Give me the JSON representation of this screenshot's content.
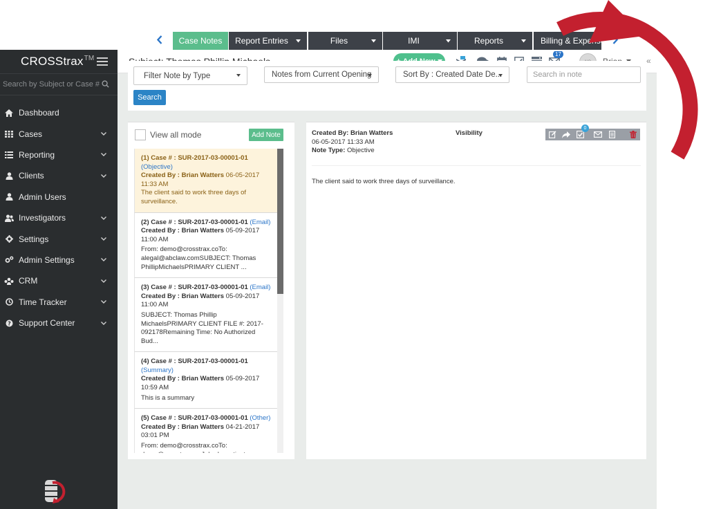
{
  "sidebar": {
    "brand": "CROSStrax",
    "brand_tm": "TM",
    "search_placeholder": "Search by Subject or Case #",
    "items": [
      {
        "label": "Dashboard",
        "icon": "home-icon"
      },
      {
        "label": "Cases",
        "icon": "grid-icon"
      },
      {
        "label": "Reporting",
        "icon": "list-icon"
      },
      {
        "label": "Clients",
        "icon": "user-icon"
      },
      {
        "label": "Admin Users",
        "icon": "user-icon"
      },
      {
        "label": "Investigators",
        "icon": "users-icon"
      },
      {
        "label": "Settings",
        "icon": "gear-icon"
      },
      {
        "label": "Admin Settings",
        "icon": "gears-icon"
      },
      {
        "label": "CRM",
        "icon": "group-icon"
      },
      {
        "label": "Time Tracker",
        "icon": "clock-icon"
      },
      {
        "label": "Support Center",
        "icon": "help-icon"
      }
    ]
  },
  "header": {
    "title": "Subject: Thomas Phillip Michaels",
    "add_new": "+ Add New",
    "mail_badge": "17",
    "user": "Brian",
    "collapse": "«"
  },
  "tabs": [
    {
      "label": "Case Notes",
      "active": true
    },
    {
      "label": "Report Entries"
    },
    {
      "label": "Files"
    },
    {
      "label": "IMI"
    },
    {
      "label": "Reports"
    },
    {
      "label": "Billing & Expense"
    }
  ],
  "filters": {
    "type": "Filter Note by Type",
    "opening": "Notes from Current Opening",
    "sort": "Sort By : Created Date De...",
    "search_placeholder": "Search in note",
    "search_button": "Search"
  },
  "notes_panel": {
    "view_all": "View all mode",
    "add_note": "Add Note",
    "notes": [
      {
        "case": "(1) Case # : SUR-2017-03-00001-01",
        "type": "(Objective)",
        "by_label": "Created By : Brian Watters",
        "date": "06-05-2017 11:33 AM",
        "body": "The client said to work three days of surveillance."
      },
      {
        "case": "(2) Case # : SUR-2017-03-00001-01",
        "type": "(Email)",
        "by_label": "Created By : Brian Watters",
        "date": "05-09-2017 11:00 AM",
        "body": "From: demo@crosstrax.coTo: alegal@abclaw.comSUBJECT: Thomas PhillipMichaelsPRIMARY CLIENT ..."
      },
      {
        "case": "(3) Case # : SUR-2017-03-00001-01",
        "type": "(Email)",
        "by_label": "Created By : Brian Watters",
        "date": "05-09-2017 11:00 AM",
        "body": "SUBJECT: Thomas Phillip MichaelsPRIMARY CLIENT FILE #: 2017-092178Remaining Time: No Authorized Bud..."
      },
      {
        "case": "(4) Case # : SUR-2017-03-00001-01",
        "type": "(Summary)",
        "by_label": "Created By : Brian Watters",
        "date": "05-09-2017 10:59 AM",
        "body": "This is a summary"
      },
      {
        "case": "(5) Case # : SUR-2017-03-00001-01",
        "type": "(Other)",
        "by_label": "Created By : Brian Watters",
        "date": "04-21-2017 03:01 PM",
        "body": "From: demo@crosstrax.coTo: demo@crosstrax.co John Investigator uploaded"
      }
    ]
  },
  "detail": {
    "created_by_label": "Created By:",
    "created_by": "Brian Watters",
    "date": "06-05-2017 11:33 AM",
    "note_type_label": "Note Type:",
    "note_type": "Objective",
    "visibility": "Visibility",
    "task_badge": "0",
    "body": "The client said to work three days of surveillance."
  },
  "colors": {
    "sidebar_bg": "#2a2d2f",
    "accent_green": "#5bbd8c",
    "tab_dark": "#3d4148",
    "link_blue": "#2b75c8",
    "arc_red": "#c3202f"
  }
}
